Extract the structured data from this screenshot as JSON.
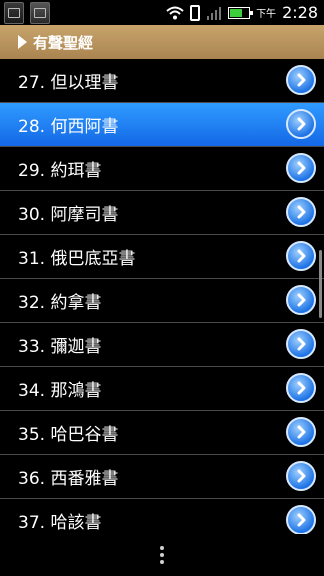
{
  "status_bar": {
    "ampm": "下午",
    "time": "2:28"
  },
  "header": {
    "title": "有聲聖經"
  },
  "list": {
    "items": [
      {
        "label": "27. 但以理書",
        "selected": false
      },
      {
        "label": "28. 何西阿書",
        "selected": true
      },
      {
        "label": "29. 約珥書",
        "selected": false
      },
      {
        "label": "30. 阿摩司書",
        "selected": false
      },
      {
        "label": "31. 俄巴底亞書",
        "selected": false
      },
      {
        "label": "32. 約拿書",
        "selected": false
      },
      {
        "label": "33. 彌迦書",
        "selected": false
      },
      {
        "label": "34. 那鴻書",
        "selected": false
      },
      {
        "label": "35. 哈巴谷書",
        "selected": false
      },
      {
        "label": "36. 西番雅書",
        "selected": false
      },
      {
        "label": "37. 哈該書",
        "selected": false
      }
    ]
  },
  "colors": {
    "header": "#b08a55",
    "selected": "#1e7cf0",
    "chevron": "#1e74e6"
  }
}
